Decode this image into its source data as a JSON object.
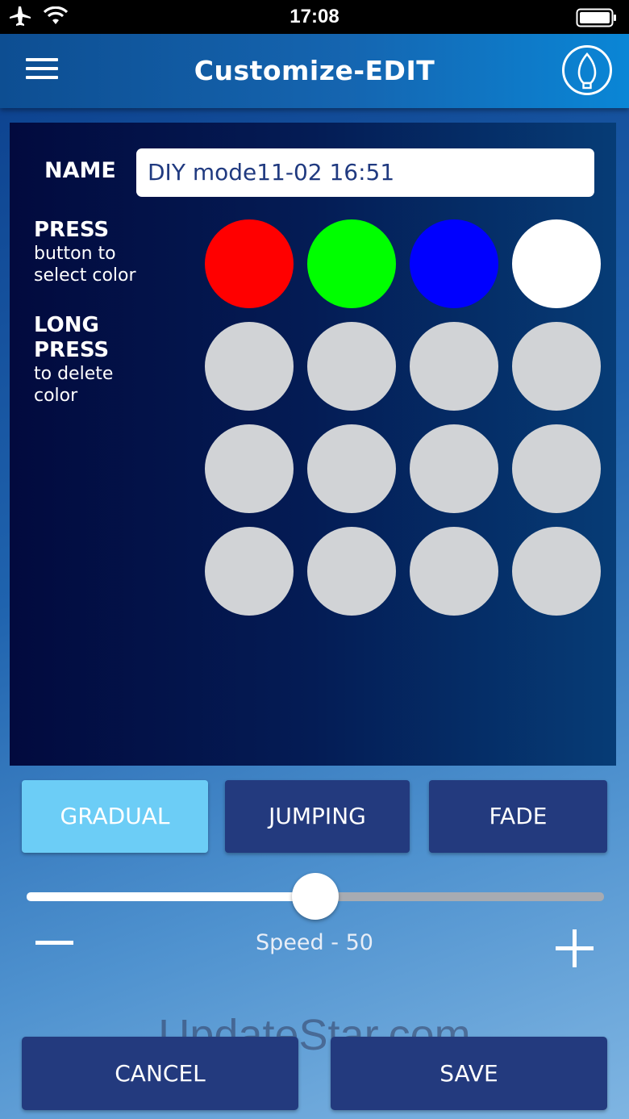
{
  "status_bar": {
    "time": "17:08"
  },
  "header": {
    "title": "Customize-EDIT",
    "menu_icon": "hamburger-menu-icon",
    "bulb_icon": "light-bulb-icon"
  },
  "editor": {
    "name_label": "NAME",
    "name_value": "DIY mode11-02 16:51",
    "press_title": "PRESS",
    "press_line1": "button to",
    "press_line2": "select color",
    "long_title1": "LONG",
    "long_title2": "PRESS",
    "long_line1": "to delete",
    "long_line2": "color",
    "swatches": [
      "#ff0000",
      "#00ff00",
      "#0000ff",
      "#ffffff",
      "#d1d3d6",
      "#d1d3d6",
      "#d1d3d6",
      "#d1d3d6",
      "#d1d3d6",
      "#d1d3d6",
      "#d1d3d6",
      "#d1d3d6",
      "#d1d3d6",
      "#d1d3d6",
      "#d1d3d6",
      "#d1d3d6"
    ]
  },
  "modes": [
    {
      "label": "GRADUAL",
      "active": true
    },
    {
      "label": "JUMPING",
      "active": false
    },
    {
      "label": "FADE",
      "active": false
    }
  ],
  "speed": {
    "label": "Speed - 50",
    "value": 50,
    "max": 100
  },
  "actions": {
    "cancel_label": "CANCEL",
    "save_label": "SAVE"
  },
  "watermark": "UpdateStar.com",
  "colors": {
    "active_mode": "#6ccdf6",
    "button": "#233a7e",
    "empty_swatch": "#d1d3d6"
  }
}
